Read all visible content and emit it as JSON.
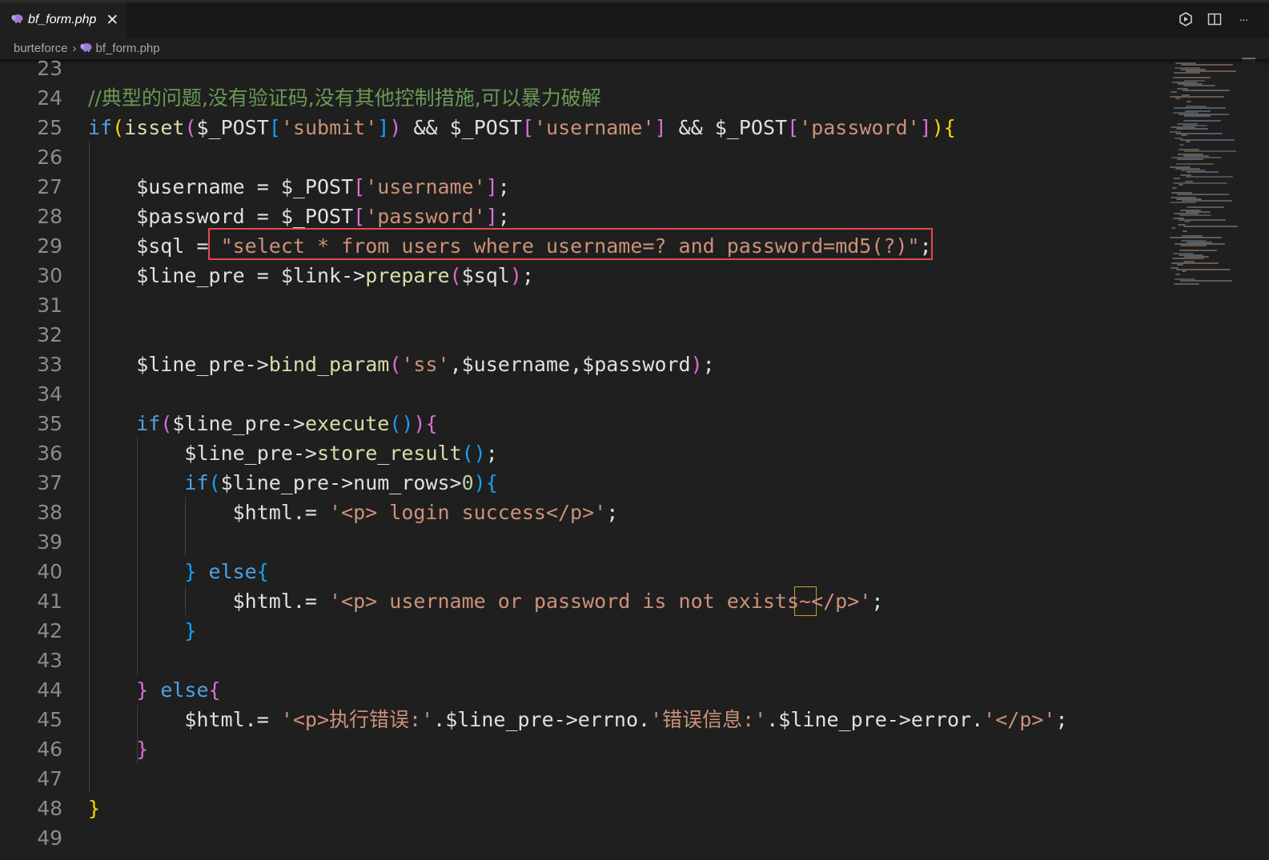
{
  "tab": {
    "filename": "bf_form.php",
    "icon": "php-elephant-icon",
    "close_glyph": "✕"
  },
  "toolbar": {
    "more_glyph": "···"
  },
  "breadcrumb": {
    "folder": "burteforce",
    "separator": "›",
    "file": "bf_form.php"
  },
  "code_lines": [
    {
      "n": "23",
      "tokens": []
    },
    {
      "n": "24",
      "tokens": [
        {
          "c": "cm",
          "t": "//典型的问题,没有验证码,没有其他控制措施,可以暴力破解"
        }
      ]
    },
    {
      "n": "25",
      "tokens": [
        {
          "c": "kw",
          "t": "if"
        },
        {
          "c": "b1",
          "t": "("
        },
        {
          "c": "fn",
          "t": "isset"
        },
        {
          "c": "b2",
          "t": "("
        },
        {
          "c": "var",
          "t": "$_POST"
        },
        {
          "c": "b3",
          "t": "["
        },
        {
          "c": "str",
          "t": "'submit'"
        },
        {
          "c": "b3",
          "t": "]"
        },
        {
          "c": "b2",
          "t": ")"
        },
        {
          "c": "var",
          "t": " && $_POST"
        },
        {
          "c": "b2",
          "t": "["
        },
        {
          "c": "str",
          "t": "'username'"
        },
        {
          "c": "b2",
          "t": "]"
        },
        {
          "c": "var",
          "t": " && $_POST"
        },
        {
          "c": "b2",
          "t": "["
        },
        {
          "c": "str",
          "t": "'password'"
        },
        {
          "c": "b2",
          "t": "]"
        },
        {
          "c": "b1",
          "t": ")"
        },
        {
          "c": "b1",
          "t": "{"
        }
      ]
    },
    {
      "n": "26",
      "tokens": []
    },
    {
      "n": "27",
      "tokens": [
        {
          "c": "var",
          "t": "    $username = $_POST"
        },
        {
          "c": "b2",
          "t": "["
        },
        {
          "c": "str",
          "t": "'username'"
        },
        {
          "c": "b2",
          "t": "]"
        },
        {
          "c": "var",
          "t": ";"
        }
      ]
    },
    {
      "n": "28",
      "tokens": [
        {
          "c": "var",
          "t": "    $password = $_POST"
        },
        {
          "c": "b2",
          "t": "["
        },
        {
          "c": "str",
          "t": "'password'"
        },
        {
          "c": "b2",
          "t": "]"
        },
        {
          "c": "var",
          "t": ";"
        }
      ]
    },
    {
      "n": "29",
      "tokens": [
        {
          "c": "var",
          "t": "    $sql = "
        },
        {
          "c": "str",
          "t": "\"select * from users where username=? and password=md5(?)\""
        },
        {
          "c": "var",
          "t": ";"
        }
      ]
    },
    {
      "n": "30",
      "tokens": [
        {
          "c": "var",
          "t": "    $line_pre = $link->"
        },
        {
          "c": "fn",
          "t": "prepare"
        },
        {
          "c": "b2",
          "t": "("
        },
        {
          "c": "var",
          "t": "$sql"
        },
        {
          "c": "b2",
          "t": ")"
        },
        {
          "c": "var",
          "t": ";"
        }
      ]
    },
    {
      "n": "31",
      "tokens": []
    },
    {
      "n": "32",
      "tokens": []
    },
    {
      "n": "33",
      "tokens": [
        {
          "c": "var",
          "t": "    $line_pre->"
        },
        {
          "c": "fn",
          "t": "bind_param"
        },
        {
          "c": "b2",
          "t": "("
        },
        {
          "c": "str",
          "t": "'ss'"
        },
        {
          "c": "var",
          "t": ",$username,$password"
        },
        {
          "c": "b2",
          "t": ")"
        },
        {
          "c": "var",
          "t": ";"
        }
      ]
    },
    {
      "n": "34",
      "tokens": []
    },
    {
      "n": "35",
      "tokens": [
        {
          "c": "kw",
          "t": "    if"
        },
        {
          "c": "b2",
          "t": "("
        },
        {
          "c": "var",
          "t": "$line_pre->"
        },
        {
          "c": "fn",
          "t": "execute"
        },
        {
          "c": "b3",
          "t": "()"
        },
        {
          "c": "b2",
          "t": ")"
        },
        {
          "c": "b2",
          "t": "{"
        }
      ]
    },
    {
      "n": "36",
      "tokens": [
        {
          "c": "var",
          "t": "        $line_pre->"
        },
        {
          "c": "fn",
          "t": "store_result"
        },
        {
          "c": "b3",
          "t": "()"
        },
        {
          "c": "var",
          "t": ";"
        }
      ]
    },
    {
      "n": "37",
      "tokens": [
        {
          "c": "kw",
          "t": "        if"
        },
        {
          "c": "b3",
          "t": "("
        },
        {
          "c": "var",
          "t": "$line_pre->num_rows>"
        },
        {
          "c": "num",
          "t": "0"
        },
        {
          "c": "b3",
          "t": ")"
        },
        {
          "c": "b3",
          "t": "{"
        }
      ]
    },
    {
      "n": "38",
      "tokens": [
        {
          "c": "var",
          "t": "            $html.= "
        },
        {
          "c": "str",
          "t": "'<p> login success</p>'"
        },
        {
          "c": "var",
          "t": ";"
        }
      ]
    },
    {
      "n": "39",
      "tokens": []
    },
    {
      "n": "40",
      "tokens": [
        {
          "c": "b3",
          "t": "        }"
        },
        {
          "c": "kw",
          "t": " else"
        },
        {
          "c": "b3",
          "t": "{"
        }
      ]
    },
    {
      "n": "41",
      "tokens": [
        {
          "c": "var",
          "t": "            $html.= "
        },
        {
          "c": "str",
          "t": "'<p> username or password is not exists~</p>'"
        },
        {
          "c": "var",
          "t": ";"
        }
      ]
    },
    {
      "n": "42",
      "tokens": [
        {
          "c": "b3",
          "t": "        }"
        }
      ]
    },
    {
      "n": "43",
      "tokens": []
    },
    {
      "n": "44",
      "tokens": [
        {
          "c": "b2",
          "t": "    }"
        },
        {
          "c": "kw",
          "t": " else"
        },
        {
          "c": "b2",
          "t": "{"
        }
      ]
    },
    {
      "n": "45",
      "tokens": [
        {
          "c": "var",
          "t": "        $html.= "
        },
        {
          "c": "str",
          "t": "'<p>执行错误:'"
        },
        {
          "c": "var",
          "t": ".$line_pre->errno."
        },
        {
          "c": "str",
          "t": "'错误信息:'"
        },
        {
          "c": "var",
          "t": ".$line_pre->error."
        },
        {
          "c": "str",
          "t": "'</p>'"
        },
        {
          "c": "var",
          "t": ";"
        }
      ]
    },
    {
      "n": "46",
      "tokens": [
        {
          "c": "b2",
          "t": "    }"
        }
      ]
    },
    {
      "n": "47",
      "tokens": []
    },
    {
      "n": "48",
      "tokens": [
        {
          "c": "b1",
          "t": "}"
        }
      ]
    },
    {
      "n": "49",
      "tokens": []
    }
  ],
  "colors": {
    "editor_bg": "#1f1f1f",
    "keyword": "#4fa0e6",
    "string": "#ce9178",
    "function": "#dcdcaa",
    "comment": "#6a9955",
    "highlight_box": "#e5484d"
  }
}
